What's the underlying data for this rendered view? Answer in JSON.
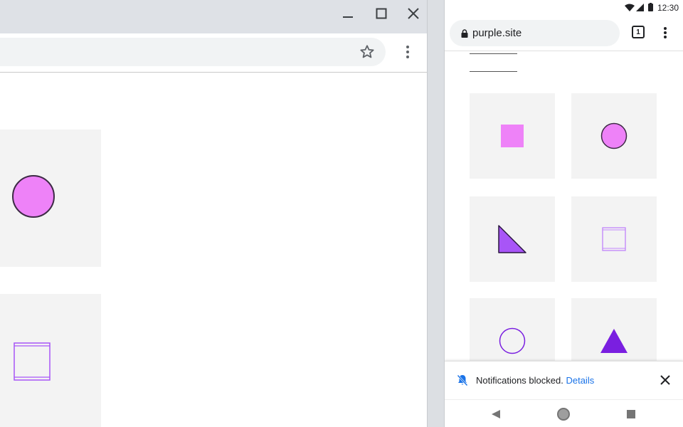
{
  "desktop": {
    "window_controls": [
      "minimize",
      "maximize",
      "close"
    ],
    "icons": [
      "star-icon",
      "more-vert-icon"
    ],
    "tiles": [
      "circle",
      "square-outline"
    ]
  },
  "mobile": {
    "status": {
      "time": "12:30"
    },
    "toolbar": {
      "url": "purple.site",
      "tab_count": "1"
    },
    "tiles": [
      "square",
      "circle",
      "right-triangle",
      "square-outline",
      "circle-outline",
      "triangle"
    ],
    "notification": {
      "message": "Notifications blocked.",
      "link": "Details"
    },
    "nav": [
      "back",
      "home",
      "recents"
    ]
  },
  "colors": {
    "pink": "#ee82f8",
    "purple": "#a855f7",
    "violet": "#7a1fe0",
    "link": "#1a73e8",
    "titlebar": "#dee1e6"
  }
}
